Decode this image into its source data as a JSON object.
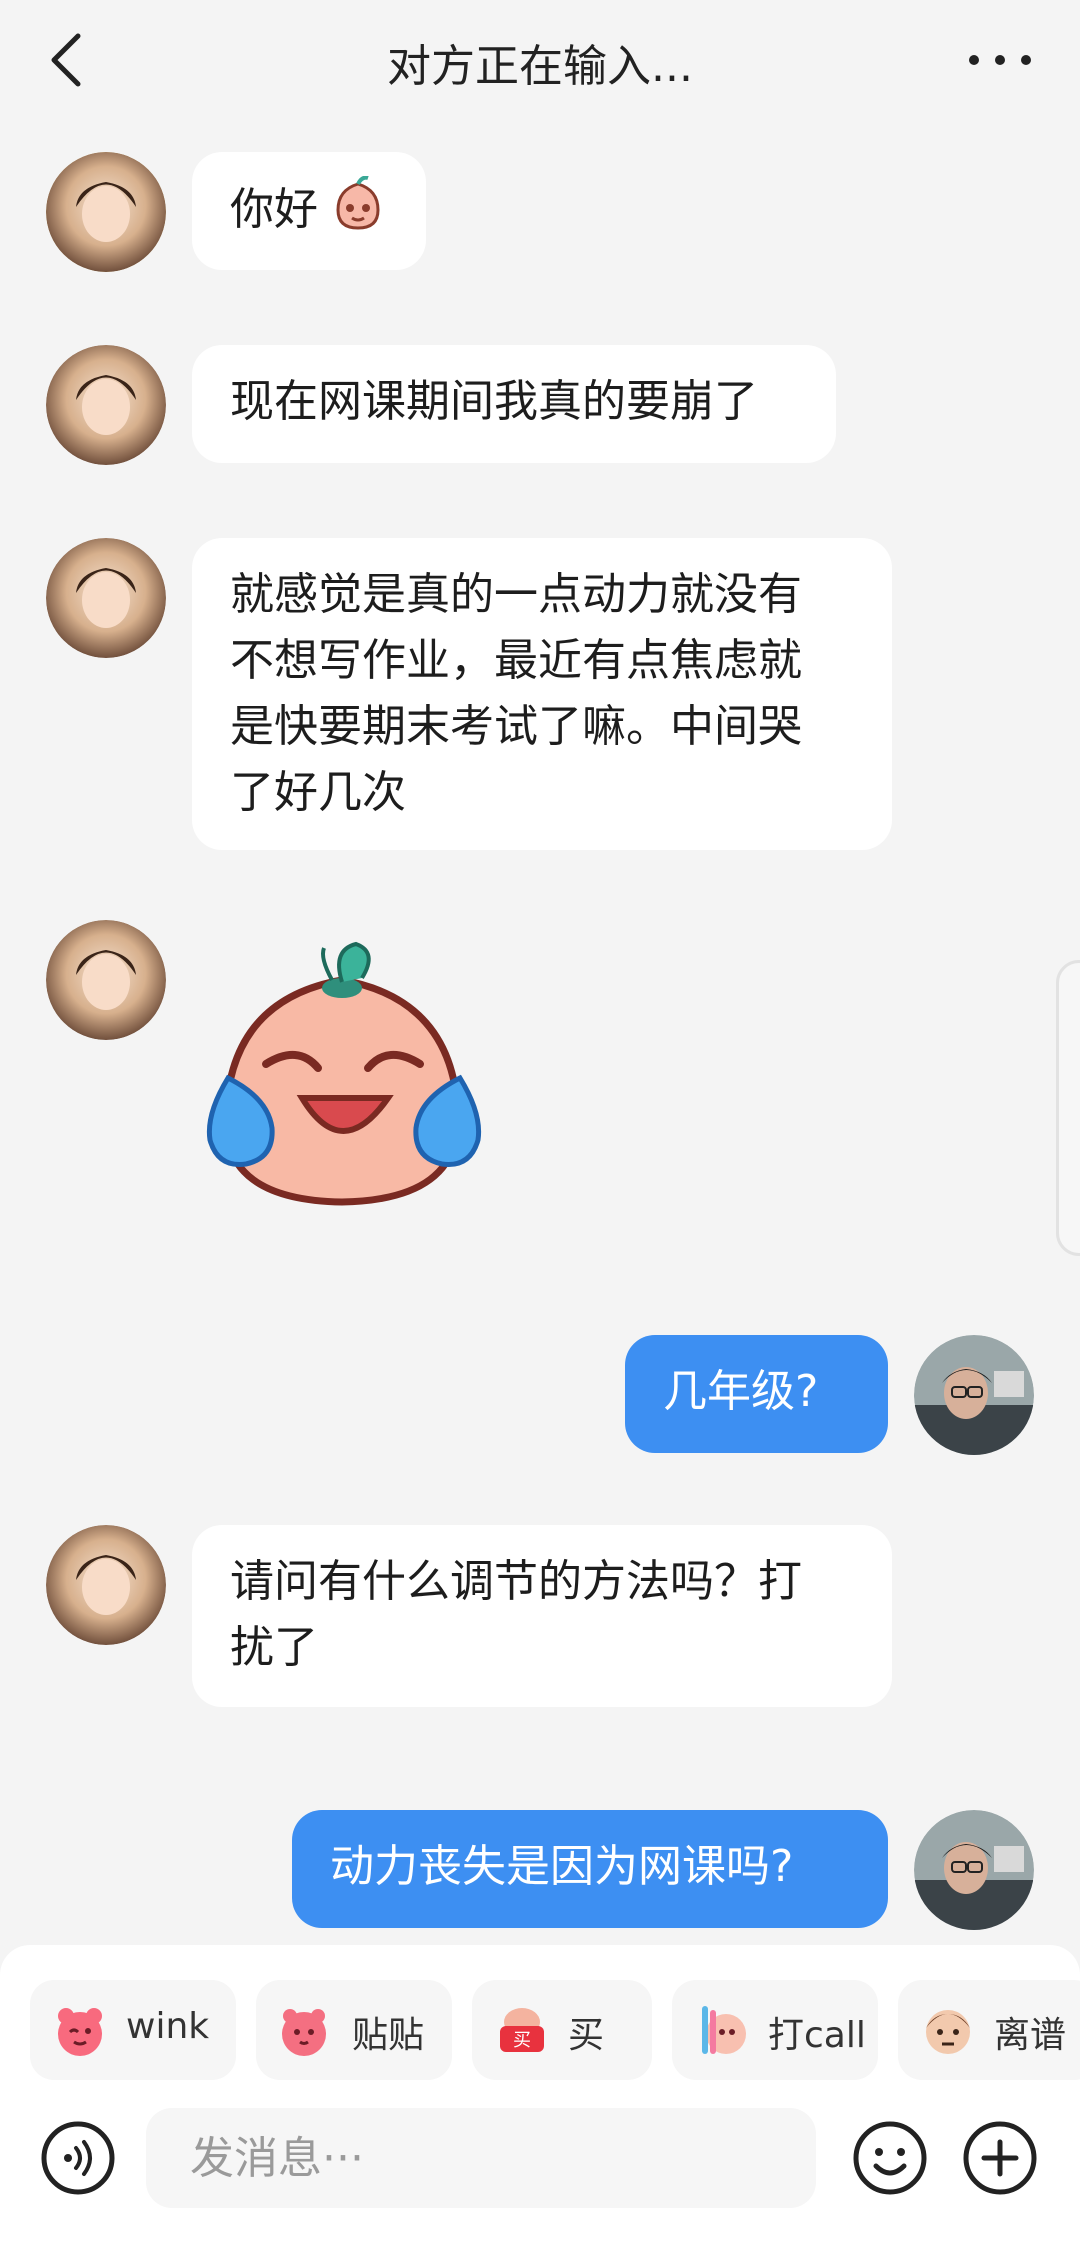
{
  "header": {
    "title": "对方正在输入..."
  },
  "messages": [
    {
      "side": "in",
      "text": "你好",
      "emoji": "peach-face-emoji"
    },
    {
      "side": "in",
      "text": "现在网课期间我真的要崩了"
    },
    {
      "side": "in",
      "lines": [
        "就感觉是真的一点动力就没有",
        "不想写作业，最近有点焦虑就",
        "是快要期末考试了嘛。中间哭",
        "了好几次"
      ]
    },
    {
      "side": "in",
      "sticker": "crying-laughing-peach-sticker"
    },
    {
      "side": "out",
      "text": "几年级?"
    },
    {
      "side": "in",
      "lines": [
        "请问有什么调节的方法吗？打",
        "扰了"
      ]
    },
    {
      "side": "out",
      "text": "动力丧失是因为网课吗?"
    }
  ],
  "quick_stickers": [
    {
      "label": "wink",
      "icon": "wink-sticker-icon"
    },
    {
      "label": "贴贴",
      "icon": "cuddle-sticker-icon"
    },
    {
      "label": "买",
      "icon": "buy-sticker-icon"
    },
    {
      "label": "打call",
      "icon": "cheer-sticker-icon"
    },
    {
      "label": "离谱",
      "icon": "absurd-sticker-icon"
    }
  ],
  "composer": {
    "placeholder": "发消息···"
  },
  "colors": {
    "outgoing_bubble": "#3d8ff2",
    "incoming_bubble": "#ffffff",
    "background": "#f4f4f4"
  }
}
